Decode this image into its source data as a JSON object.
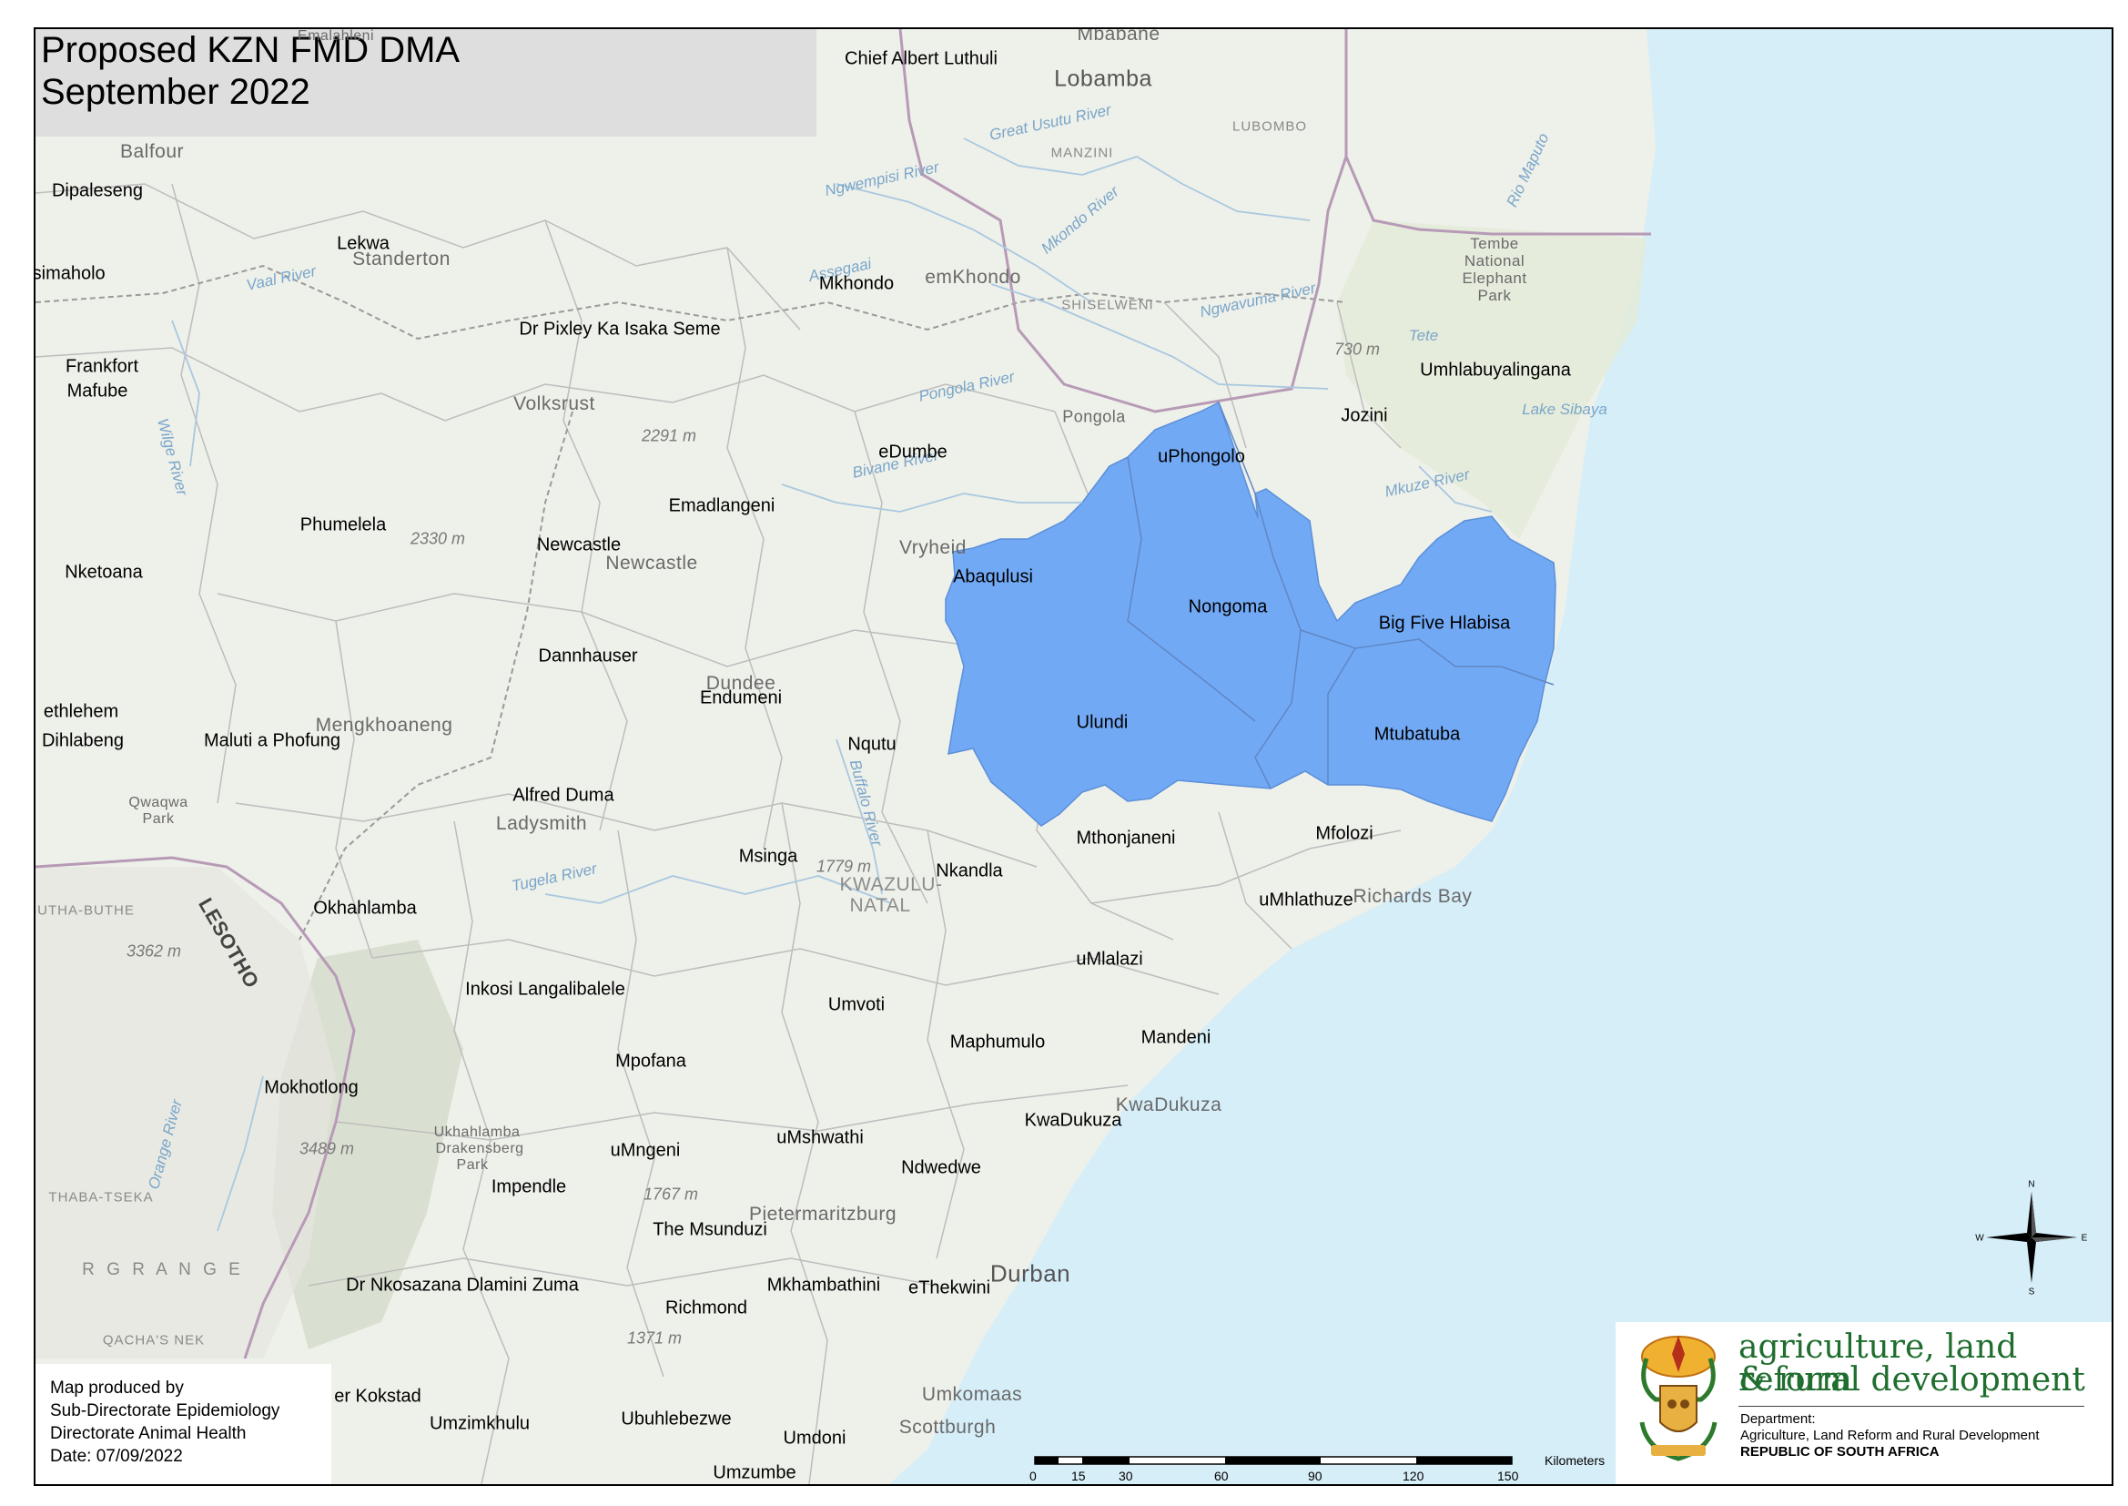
{
  "title": {
    "line1": "Proposed KZN FMD DMA",
    "line2": "September 2022"
  },
  "credits": {
    "line1": "Map produced by",
    "line2": "Sub-Directorate Epidemiology",
    "line3": "Directorate Animal Health",
    "line4": "Date: 07/09/2022"
  },
  "department": {
    "name_line1": "agriculture, land reform",
    "name_line2": "& rural development",
    "sub_line1": "Department:",
    "sub_line2": "Agriculture, Land Reform and Rural Development",
    "sub_line3": "REPUBLIC OF SOUTH AFRICA"
  },
  "colors": {
    "dma_fill": "#72a9f5",
    "ocean": "#d6eef8",
    "land": "#eef0ea"
  },
  "highlighted_areas": [
    "Nongoma",
    "Big Five Hlabisa",
    "Ulundi",
    "Mtubatuba"
  ],
  "municipalities": [
    "Chief Albert Luthuli",
    "Dipaleseng",
    "Lekwa",
    "Metsimaholo",
    "Mkhondo",
    "Dr Pixley Ka Isaka Seme",
    "Frankfort",
    "Mafube",
    "Umhlabuyalingana",
    "Jozini",
    "eDumbe",
    "uPhongolo",
    "Emadlangeni",
    "Phumelela",
    "Newcastle",
    "Nketoana",
    "Abaqulusi",
    "Nongoma",
    "Big Five Hlabisa",
    "Dannhauser",
    "Endumeni",
    "Ulundi",
    "Mtubatuba",
    "Dihlabeng",
    "Maluti a Phofung",
    "Nqutu",
    "Alfred Duma",
    "Mthonjaneni",
    "Mfolozi",
    "Msinga",
    "Nkandla",
    "uMhlathuze",
    "Okhahlamba",
    "uMlalazi",
    "Inkosi Langalibalele",
    "Umvoti",
    "Mandeni",
    "Maphumulo",
    "Mpofana",
    "Mokhotlong",
    "KwaDukuza",
    "uMshwathi",
    "uMngeni",
    "Ndwedwe",
    "Impendle",
    "The Msunduzi",
    "Dr Nkosazana Dlamini Zuma",
    "Mkhambathini",
    "eThekwini",
    "Richmond",
    "er Kokstad",
    "Umzimkhulu",
    "Ubuhlebezwe",
    "Umdoni",
    "Umzumbe",
    "ethlehem"
  ],
  "basemap_places": [
    "Mbabane",
    "Lobamba",
    "Balfour",
    "Standerton",
    "emKhondo",
    "Volksrust",
    "Pongola",
    "Vryheid",
    "Newcastle",
    "Dundee",
    "Mengkhoaneng",
    "Ladysmith",
    "Richards Bay",
    "KwaDukuza",
    "Pietermaritzburg",
    "Durban",
    "Umkomaas",
    "Scottburgh",
    "KWAZULU-",
    "NATAL",
    "LESOTHO",
    "Tembe",
    "National",
    "Elephant",
    "Park",
    "Qwaqwa",
    "Park",
    "Ukhahlamba",
    "Drakensberg",
    "Park",
    "Emalahleni"
  ],
  "regions": [
    "MANZINI",
    "LUBOMBO",
    "SHISELWENI",
    "BUTHA-BUTHE",
    "THABA-TSEKA",
    "QACHA'S NEK",
    "R G R A N G E"
  ],
  "water_labels": [
    "Great Usutu River",
    "Ngwempisi River",
    "Mkondo River",
    "Ngwavuma River",
    "Rio Maputo",
    "Vaal River",
    "Wilge River",
    "Pongola River",
    "Bivane River",
    "Mkuze River",
    "Lake Sibaya",
    "Tugela River",
    "Buffalo River",
    "Orange River",
    "Tete",
    "Assegaai"
  ],
  "elevations": [
    "2291 m",
    "2330 m",
    "730 m",
    "1779 m",
    "3362 m",
    "3489 m",
    "1767 m",
    "1371 m"
  ],
  "compass": {
    "n": "N",
    "e": "E",
    "s": "S",
    "w": "W"
  },
  "scale": {
    "unit": "Kilometers",
    "ticks": [
      "0",
      "15",
      "30",
      "60",
      "90",
      "120",
      "150"
    ]
  }
}
